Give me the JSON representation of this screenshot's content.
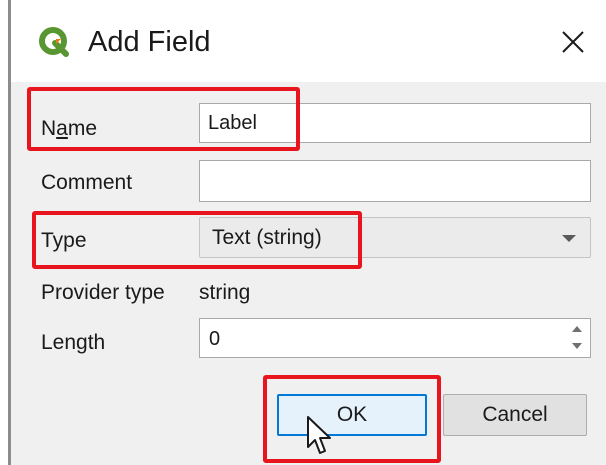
{
  "window": {
    "title": "Add Field",
    "close_symbol": "×"
  },
  "form": {
    "name": {
      "label_prefix": "N",
      "label_underlined": "a",
      "label_suffix": "me",
      "value": "Label"
    },
    "comment": {
      "label": "Comment",
      "value": ""
    },
    "type": {
      "label": "Type",
      "selected": "Text (string)"
    },
    "provider_type": {
      "label": "Provider type",
      "value": "string"
    },
    "length": {
      "label": "Length",
      "value": "0"
    }
  },
  "buttons": {
    "ok_label": "OK",
    "cancel_label": "Cancel"
  },
  "icons": {
    "app": "qgis-logo-icon",
    "close": "close-icon",
    "dropdown": "chevron-down-icon",
    "cursor": "mouse-pointer-icon"
  },
  "colors": {
    "highlight": "#e8141e",
    "ok_border": "#0078d7",
    "qgis_green": "#589632",
    "qgis_yellow": "#ee7913"
  }
}
